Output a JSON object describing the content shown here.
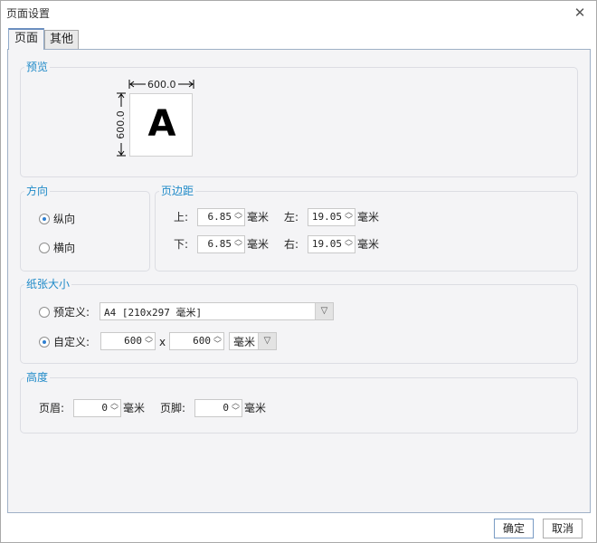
{
  "window": {
    "title": "页面设置",
    "close_glyph": "✕"
  },
  "tabs": [
    {
      "label": "页面",
      "active": true
    },
    {
      "label": "其他",
      "active": false
    }
  ],
  "preview": {
    "title": "预览",
    "width_label": "600.0",
    "height_label": "600.0",
    "letter": "A"
  },
  "orientation": {
    "title": "方向",
    "portrait_label": "纵向",
    "landscape_label": "横向",
    "selected": "portrait"
  },
  "margins": {
    "title": "页边距",
    "top_label": "上:",
    "top_value": "6.85",
    "left_label": "左:",
    "left_value": "19.05",
    "bottom_label": "下:",
    "bottom_value": "6.85",
    "right_label": "右:",
    "right_value": "19.05",
    "unit": "毫米"
  },
  "paper": {
    "title": "纸张大小",
    "predefined_label": "预定义:",
    "predefined_value": "A4 [210x297 毫米]",
    "custom_label": "自定义:",
    "custom_width": "600",
    "custom_x": "x",
    "custom_height": "600",
    "custom_unit": "毫米",
    "selected": "custom"
  },
  "height": {
    "title": "高度",
    "header_label": "页眉:",
    "header_value": "0",
    "header_unit": "毫米",
    "footer_label": "页脚:",
    "footer_value": "0",
    "footer_unit": "毫米"
  },
  "buttons": {
    "ok_label": "确定",
    "cancel_label": "取消"
  }
}
